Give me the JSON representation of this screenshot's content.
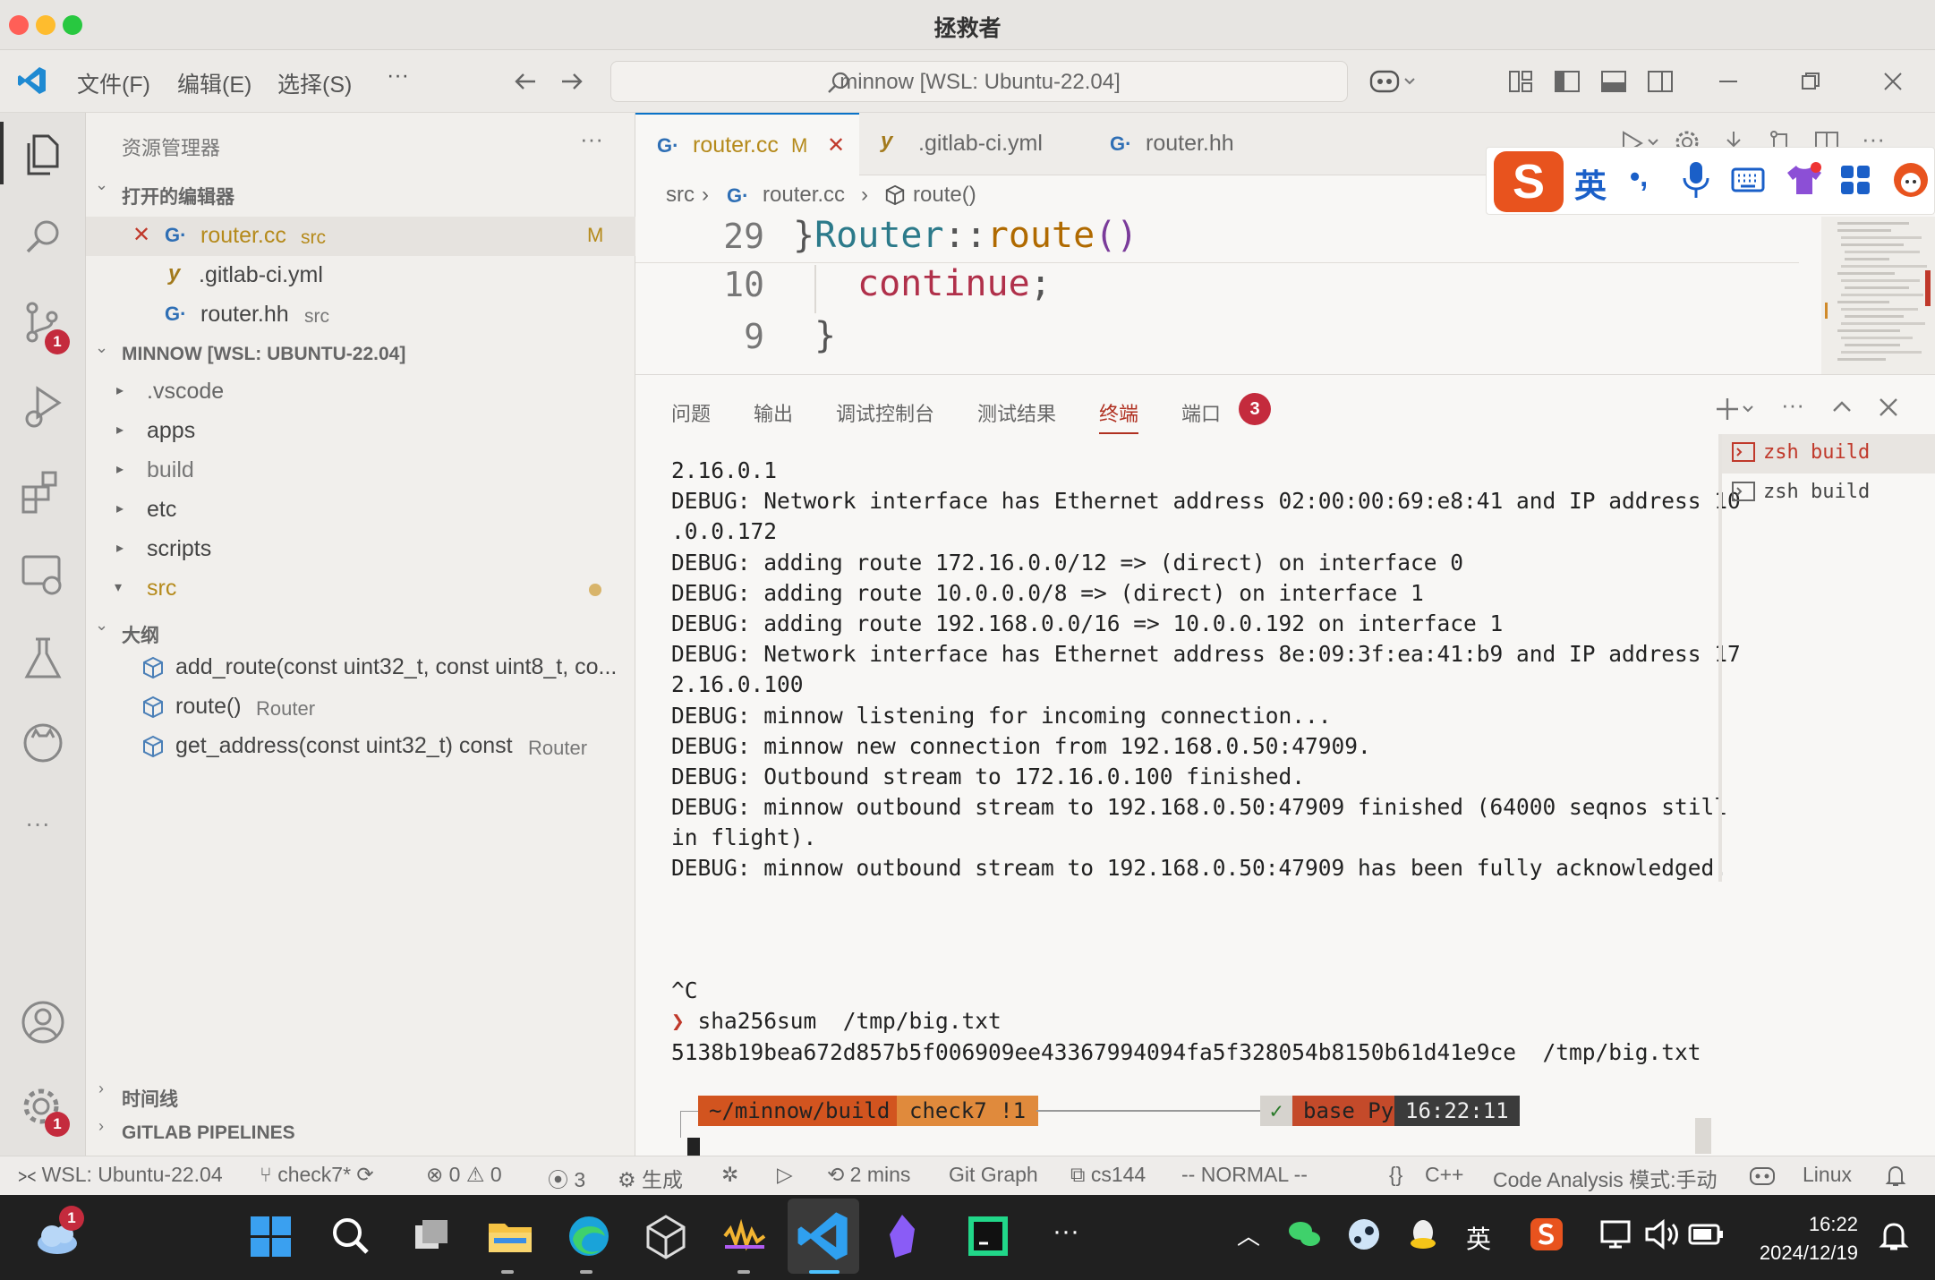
{
  "window": {
    "title": "拯救者"
  },
  "menubar": {
    "items": [
      "文件(F)",
      "编辑(E)",
      "选择(S)"
    ],
    "more": "···",
    "command_center": "minnow [WSL: Ubuntu-22.04]"
  },
  "activity_badges": {
    "scm": "1",
    "settings": "1"
  },
  "sidebar": {
    "title": "资源管理器",
    "more": "···",
    "open_editors_header": "打开的编辑器",
    "open_editors": [
      {
        "name": "router.cc",
        "path": "src",
        "status": "M"
      },
      {
        "name": ".gitlab-ci.yml",
        "path": ""
      },
      {
        "name": "router.hh",
        "path": "src"
      }
    ],
    "workspace_header": "MINNOW [WSL: UBUNTU-22.04]",
    "folders": [
      ".vscode",
      "apps",
      "build",
      "etc",
      "scripts",
      "src"
    ],
    "outline_header": "大纲",
    "outline": [
      {
        "name": "add_route(const uint32_t, const uint8_t, co...",
        "detail": ""
      },
      {
        "name": "route()",
        "detail": "Router"
      },
      {
        "name": "get_address(const uint32_t) const",
        "detail": "Router"
      }
    ],
    "timeline_header": "时间线",
    "gitlab_header": "GITLAB PIPELINES"
  },
  "editor": {
    "tabs": [
      {
        "label": "router.cc",
        "status": "M",
        "active": true
      },
      {
        "label": ".gitlab-ci.yml"
      },
      {
        "label": "router.hh"
      }
    ],
    "breadcrumb": [
      "src",
      "router.cc",
      "route()"
    ],
    "lines": [
      {
        "num": "29",
        "prefix": "}",
        "class": "Router",
        "sep": "::",
        "fn": "route",
        "parens": "()"
      },
      {
        "num": "10",
        "keyword": "continue",
        "punct": ";"
      },
      {
        "num": "9",
        "brace": "}"
      }
    ]
  },
  "ime": {
    "lang": "英",
    "punct": "•,"
  },
  "panel": {
    "tabs": [
      "问题",
      "输出",
      "调试控制台",
      "测试结果",
      "终端",
      "端口"
    ],
    "ports_badge": "3",
    "terminals": [
      "zsh build",
      "zsh build"
    ],
    "terminal_lines": [
      "2.16.0.1",
      "DEBUG: Network interface has Ethernet address 02:00:00:69:e8:41 and IP address 10",
      ".0.0.172",
      "DEBUG: adding route 172.16.0.0/12 => (direct) on interface 0",
      "DEBUG: adding route 10.0.0.0/8 => (direct) on interface 1",
      "DEBUG: adding route 192.168.0.0/16 => 10.0.0.192 on interface 1",
      "DEBUG: Network interface has Ethernet address 8e:09:3f:ea:41:b9 and IP address 17",
      "2.16.0.100",
      "DEBUG: minnow listening for incoming connection...",
      "DEBUG: minnow new connection from 192.168.0.50:47909.",
      "DEBUG: Outbound stream to 172.16.0.100 finished.",
      "DEBUG: minnow outbound stream to 192.168.0.50:47909 finished (64000 seqnos still",
      "in flight).",
      "DEBUG: minnow outbound stream to 192.168.0.50:47909 has been fully acknowledged.",
      "",
      "",
      "",
      "^C"
    ],
    "command": "sha256sum  /tmp/big.txt",
    "command_output": "5138b19bea672d857b5f006909ee43367994094fa5f328054b8150b61d41e9ce  /tmp/big.txt",
    "prompt": {
      "path": "~/minnow/build",
      "branch": "check7 !1",
      "check": "✓",
      "env": "base Py",
      "time": "16:22:11"
    }
  },
  "statusbar": {
    "remote": "WSL: Ubuntu-22.04",
    "branch": "check7*",
    "errors": "0",
    "warnings": "0",
    "info": "3",
    "build": "生成",
    "time_ago": "2 mins",
    "git_graph": "Git Graph",
    "project": "cs144",
    "mode": "-- NORMAL --",
    "lang_icon": "{}",
    "lang": "C++",
    "analysis": "Code Analysis 模式:手动",
    "os": "Linux"
  },
  "taskbar": {
    "weather_badge": "1",
    "tray_lang": "英",
    "time": "16:22",
    "date": "2024/12/19",
    "more": "···"
  },
  "colors": {
    "accent": "#0a73c8",
    "modified": "#b58a1b",
    "badge": "#c42b3d",
    "prompt_path_bg": "#d2541f",
    "prompt_branch_bg": "#e08a3c",
    "prompt_env_bg": "#c44a2a",
    "prompt_time_bg": "#3b3b3b"
  }
}
